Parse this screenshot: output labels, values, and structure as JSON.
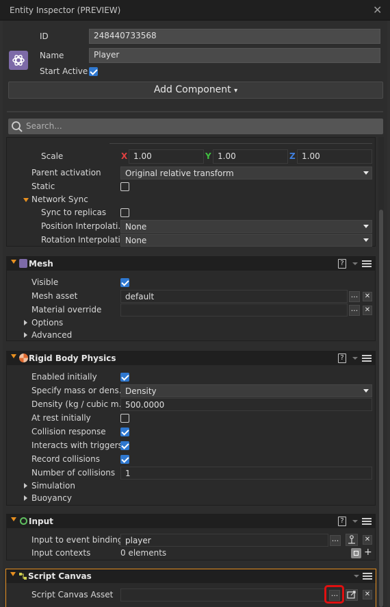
{
  "window": {
    "title": "Entity Inspector (PREVIEW)",
    "close_glyph": "✕"
  },
  "entity": {
    "id_label": "ID",
    "id_value": "248440733568",
    "name_label": "Name",
    "name_value": "Player",
    "start_active_label": "Start Active",
    "start_active": true,
    "icon": "entity-icon"
  },
  "add_component": {
    "label": "Add Component",
    "arrow": "▾"
  },
  "search": {
    "placeholder": "Search...",
    "icon": "search-icon"
  },
  "transform": {
    "scale_label": "Scale",
    "x_axis": "X",
    "y_axis": "Y",
    "z_axis": "Z",
    "x_value": "1.00",
    "y_value": "1.00",
    "z_value": "1.00",
    "parent_activation_label": "Parent activation",
    "parent_activation_value": "Original relative transform",
    "static_label": "Static",
    "static": false,
    "network_sync_label": "Network Sync",
    "sync_to_replicas_label": "Sync to replicas",
    "sync_to_replicas": false,
    "position_interp_label": "Position Interpolati...",
    "position_interp_value": "None",
    "rotation_interp_label": "Rotation Interpolati...",
    "rotation_interp_value": "None"
  },
  "mesh": {
    "title": "Mesh",
    "help": "?",
    "visible_label": "Visible",
    "visible": true,
    "mesh_asset_label": "Mesh asset",
    "mesh_asset_value": "default",
    "material_override_label": "Material override",
    "material_override_value": "",
    "options_label": "Options",
    "advanced_label": "Advanced"
  },
  "rigid_body": {
    "title": "Rigid Body Physics",
    "help": "?",
    "enabled_initially_label": "Enabled initially",
    "enabled_initially": true,
    "specify_mass_label": "Specify mass or dens...",
    "specify_mass_value": "Density",
    "density_label": "Density (kg / cubic m...",
    "density_value": "500.0000",
    "at_rest_label": "At rest initially",
    "at_rest": false,
    "collision_response_label": "Collision response",
    "collision_response": true,
    "interacts_triggers_label": "Interacts with triggers",
    "interacts_triggers": true,
    "record_collisions_label": "Record collisions",
    "record_collisions": true,
    "num_collisions_label": "Number of collisions",
    "num_collisions_value": "1",
    "simulation_label": "Simulation",
    "buoyancy_label": "Buoyancy"
  },
  "input": {
    "title": "Input",
    "help": "?",
    "bindings_label": "Input to event bindings",
    "bindings_value": "player",
    "contexts_label": "Input contexts",
    "contexts_value": "0 elements"
  },
  "script_canvas": {
    "title": "Script Canvas",
    "asset_label": "Script Canvas Asset",
    "asset_value": ""
  },
  "glyphs": {
    "dots": "...",
    "x": "✕",
    "plus": "+"
  },
  "colors": {
    "accent_orange": "#e89020",
    "checkbox_blue": "#2f78d0",
    "x_red": "#e04040",
    "y_green": "#40c040",
    "z_blue": "#4080e0",
    "highlight_red": "#e01010"
  }
}
